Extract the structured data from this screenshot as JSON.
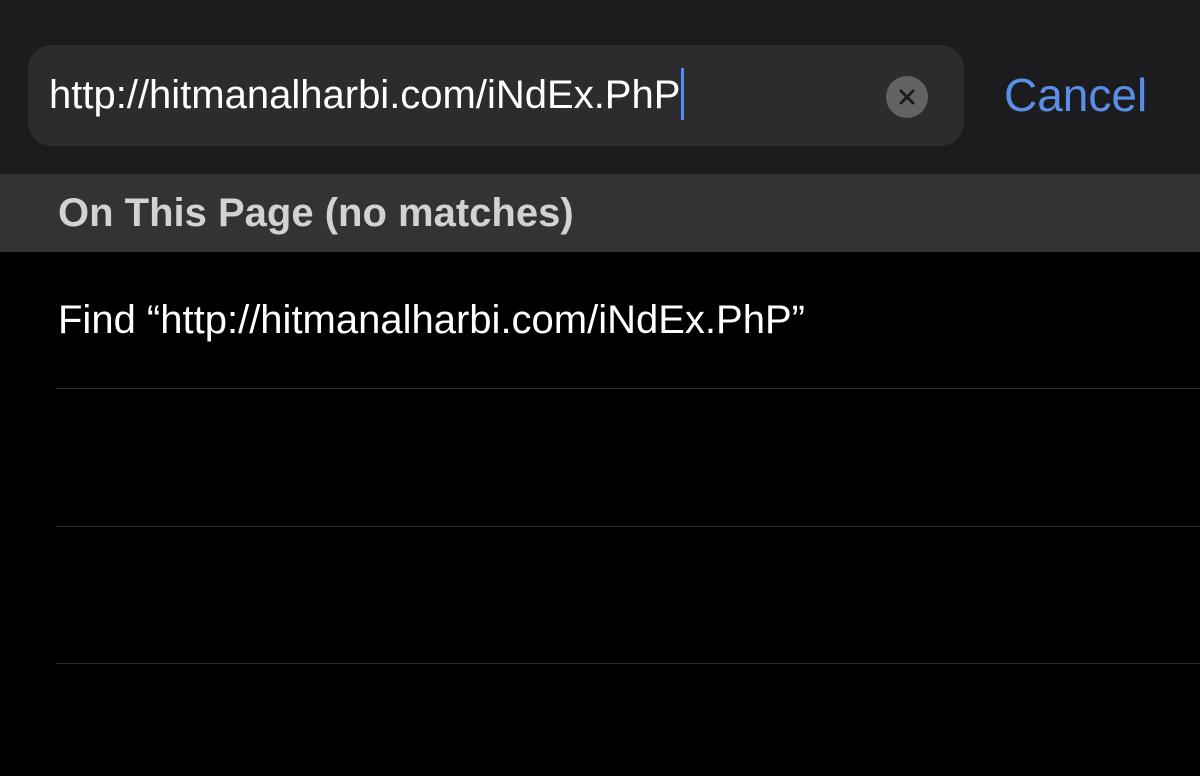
{
  "search": {
    "value": "http://hitmanalharbi.com/iNdEx.PhP",
    "clear_icon": "xmark-circle-icon"
  },
  "cancel_label": "Cancel",
  "section": {
    "title": "On This Page (no matches)"
  },
  "results": [
    {
      "label": "Find “http://hitmanalharbi.com/iNdEx.PhP”"
    },
    {
      "label": ""
    },
    {
      "label": ""
    }
  ],
  "colors": {
    "accent": "#5a8fe8",
    "caret": "#4f8ef7",
    "background": "#000000",
    "bar_background": "#1c1c1e",
    "field_background": "#2c2c2e",
    "section_background": "#333336"
  }
}
